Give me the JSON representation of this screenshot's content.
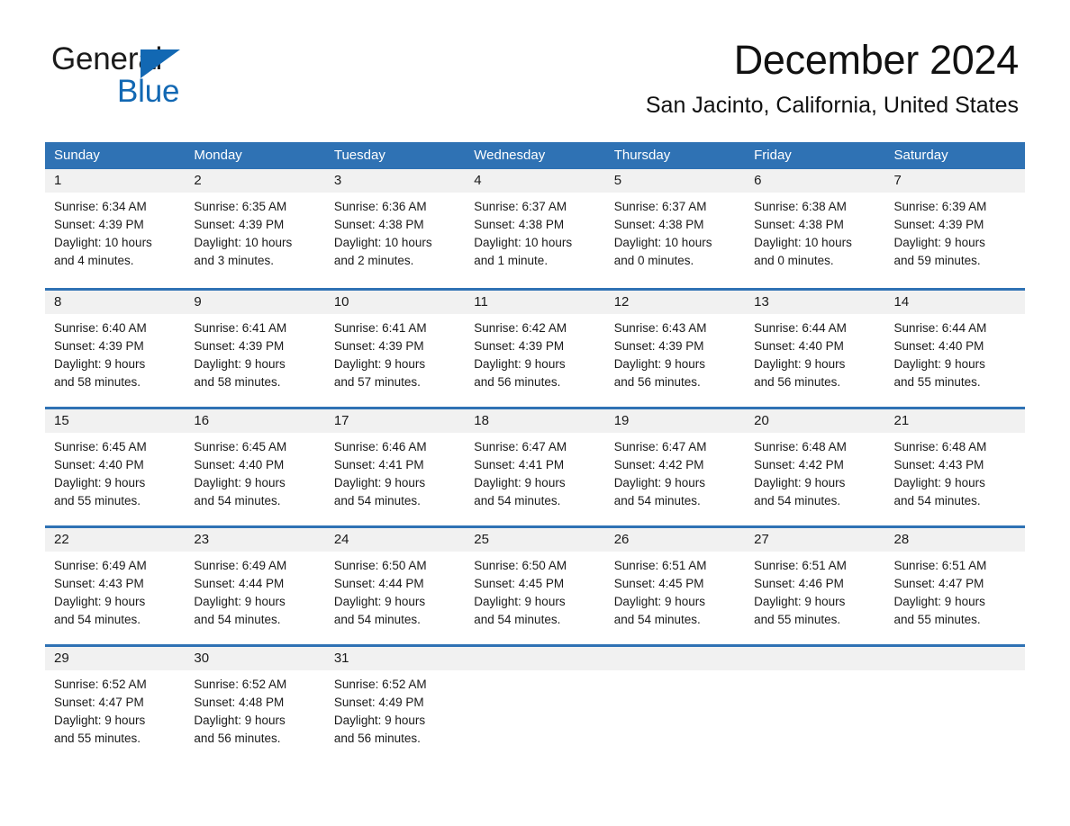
{
  "brand": {
    "name_part1": "General",
    "name_part2": "Blue",
    "accent_color": "#1268b3",
    "triangle_icon": "triangle-icon"
  },
  "header": {
    "month_title": "December 2024",
    "location": "San Jacinto, California, United States"
  },
  "theme": {
    "header_blue": "#2f72b4",
    "row_divider_blue": "#2f72b4",
    "day_band_gray": "#f1f1f1",
    "text_black": "#1a1a1a"
  },
  "calendar": {
    "weekdays": [
      "Sunday",
      "Monday",
      "Tuesday",
      "Wednesday",
      "Thursday",
      "Friday",
      "Saturday"
    ],
    "weeks": [
      [
        {
          "day": "1",
          "sunrise": "Sunrise: 6:34 AM",
          "sunset": "Sunset: 4:39 PM",
          "daylight_line1": "Daylight: 10 hours",
          "daylight_line2": "and 4 minutes."
        },
        {
          "day": "2",
          "sunrise": "Sunrise: 6:35 AM",
          "sunset": "Sunset: 4:39 PM",
          "daylight_line1": "Daylight: 10 hours",
          "daylight_line2": "and 3 minutes."
        },
        {
          "day": "3",
          "sunrise": "Sunrise: 6:36 AM",
          "sunset": "Sunset: 4:38 PM",
          "daylight_line1": "Daylight: 10 hours",
          "daylight_line2": "and 2 minutes."
        },
        {
          "day": "4",
          "sunrise": "Sunrise: 6:37 AM",
          "sunset": "Sunset: 4:38 PM",
          "daylight_line1": "Daylight: 10 hours",
          "daylight_line2": "and 1 minute."
        },
        {
          "day": "5",
          "sunrise": "Sunrise: 6:37 AM",
          "sunset": "Sunset: 4:38 PM",
          "daylight_line1": "Daylight: 10 hours",
          "daylight_line2": "and 0 minutes."
        },
        {
          "day": "6",
          "sunrise": "Sunrise: 6:38 AM",
          "sunset": "Sunset: 4:38 PM",
          "daylight_line1": "Daylight: 10 hours",
          "daylight_line2": "and 0 minutes."
        },
        {
          "day": "7",
          "sunrise": "Sunrise: 6:39 AM",
          "sunset": "Sunset: 4:39 PM",
          "daylight_line1": "Daylight: 9 hours",
          "daylight_line2": "and 59 minutes."
        }
      ],
      [
        {
          "day": "8",
          "sunrise": "Sunrise: 6:40 AM",
          "sunset": "Sunset: 4:39 PM",
          "daylight_line1": "Daylight: 9 hours",
          "daylight_line2": "and 58 minutes."
        },
        {
          "day": "9",
          "sunrise": "Sunrise: 6:41 AM",
          "sunset": "Sunset: 4:39 PM",
          "daylight_line1": "Daylight: 9 hours",
          "daylight_line2": "and 58 minutes."
        },
        {
          "day": "10",
          "sunrise": "Sunrise: 6:41 AM",
          "sunset": "Sunset: 4:39 PM",
          "daylight_line1": "Daylight: 9 hours",
          "daylight_line2": "and 57 minutes."
        },
        {
          "day": "11",
          "sunrise": "Sunrise: 6:42 AM",
          "sunset": "Sunset: 4:39 PM",
          "daylight_line1": "Daylight: 9 hours",
          "daylight_line2": "and 56 minutes."
        },
        {
          "day": "12",
          "sunrise": "Sunrise: 6:43 AM",
          "sunset": "Sunset: 4:39 PM",
          "daylight_line1": "Daylight: 9 hours",
          "daylight_line2": "and 56 minutes."
        },
        {
          "day": "13",
          "sunrise": "Sunrise: 6:44 AM",
          "sunset": "Sunset: 4:40 PM",
          "daylight_line1": "Daylight: 9 hours",
          "daylight_line2": "and 56 minutes."
        },
        {
          "day": "14",
          "sunrise": "Sunrise: 6:44 AM",
          "sunset": "Sunset: 4:40 PM",
          "daylight_line1": "Daylight: 9 hours",
          "daylight_line2": "and 55 minutes."
        }
      ],
      [
        {
          "day": "15",
          "sunrise": "Sunrise: 6:45 AM",
          "sunset": "Sunset: 4:40 PM",
          "daylight_line1": "Daylight: 9 hours",
          "daylight_line2": "and 55 minutes."
        },
        {
          "day": "16",
          "sunrise": "Sunrise: 6:45 AM",
          "sunset": "Sunset: 4:40 PM",
          "daylight_line1": "Daylight: 9 hours",
          "daylight_line2": "and 54 minutes."
        },
        {
          "day": "17",
          "sunrise": "Sunrise: 6:46 AM",
          "sunset": "Sunset: 4:41 PM",
          "daylight_line1": "Daylight: 9 hours",
          "daylight_line2": "and 54 minutes."
        },
        {
          "day": "18",
          "sunrise": "Sunrise: 6:47 AM",
          "sunset": "Sunset: 4:41 PM",
          "daylight_line1": "Daylight: 9 hours",
          "daylight_line2": "and 54 minutes."
        },
        {
          "day": "19",
          "sunrise": "Sunrise: 6:47 AM",
          "sunset": "Sunset: 4:42 PM",
          "daylight_line1": "Daylight: 9 hours",
          "daylight_line2": "and 54 minutes."
        },
        {
          "day": "20",
          "sunrise": "Sunrise: 6:48 AM",
          "sunset": "Sunset: 4:42 PM",
          "daylight_line1": "Daylight: 9 hours",
          "daylight_line2": "and 54 minutes."
        },
        {
          "day": "21",
          "sunrise": "Sunrise: 6:48 AM",
          "sunset": "Sunset: 4:43 PM",
          "daylight_line1": "Daylight: 9 hours",
          "daylight_line2": "and 54 minutes."
        }
      ],
      [
        {
          "day": "22",
          "sunrise": "Sunrise: 6:49 AM",
          "sunset": "Sunset: 4:43 PM",
          "daylight_line1": "Daylight: 9 hours",
          "daylight_line2": "and 54 minutes."
        },
        {
          "day": "23",
          "sunrise": "Sunrise: 6:49 AM",
          "sunset": "Sunset: 4:44 PM",
          "daylight_line1": "Daylight: 9 hours",
          "daylight_line2": "and 54 minutes."
        },
        {
          "day": "24",
          "sunrise": "Sunrise: 6:50 AM",
          "sunset": "Sunset: 4:44 PM",
          "daylight_line1": "Daylight: 9 hours",
          "daylight_line2": "and 54 minutes."
        },
        {
          "day": "25",
          "sunrise": "Sunrise: 6:50 AM",
          "sunset": "Sunset: 4:45 PM",
          "daylight_line1": "Daylight: 9 hours",
          "daylight_line2": "and 54 minutes."
        },
        {
          "day": "26",
          "sunrise": "Sunrise: 6:51 AM",
          "sunset": "Sunset: 4:45 PM",
          "daylight_line1": "Daylight: 9 hours",
          "daylight_line2": "and 54 minutes."
        },
        {
          "day": "27",
          "sunrise": "Sunrise: 6:51 AM",
          "sunset": "Sunset: 4:46 PM",
          "daylight_line1": "Daylight: 9 hours",
          "daylight_line2": "and 55 minutes."
        },
        {
          "day": "28",
          "sunrise": "Sunrise: 6:51 AM",
          "sunset": "Sunset: 4:47 PM",
          "daylight_line1": "Daylight: 9 hours",
          "daylight_line2": "and 55 minutes."
        }
      ],
      [
        {
          "day": "29",
          "sunrise": "Sunrise: 6:52 AM",
          "sunset": "Sunset: 4:47 PM",
          "daylight_line1": "Daylight: 9 hours",
          "daylight_line2": "and 55 minutes."
        },
        {
          "day": "30",
          "sunrise": "Sunrise: 6:52 AM",
          "sunset": "Sunset: 4:48 PM",
          "daylight_line1": "Daylight: 9 hours",
          "daylight_line2": "and 56 minutes."
        },
        {
          "day": "31",
          "sunrise": "Sunrise: 6:52 AM",
          "sunset": "Sunset: 4:49 PM",
          "daylight_line1": "Daylight: 9 hours",
          "daylight_line2": "and 56 minutes."
        },
        {
          "day": "",
          "sunrise": "",
          "sunset": "",
          "daylight_line1": "",
          "daylight_line2": ""
        },
        {
          "day": "",
          "sunrise": "",
          "sunset": "",
          "daylight_line1": "",
          "daylight_line2": ""
        },
        {
          "day": "",
          "sunrise": "",
          "sunset": "",
          "daylight_line1": "",
          "daylight_line2": ""
        },
        {
          "day": "",
          "sunrise": "",
          "sunset": "",
          "daylight_line1": "",
          "daylight_line2": ""
        }
      ]
    ]
  }
}
